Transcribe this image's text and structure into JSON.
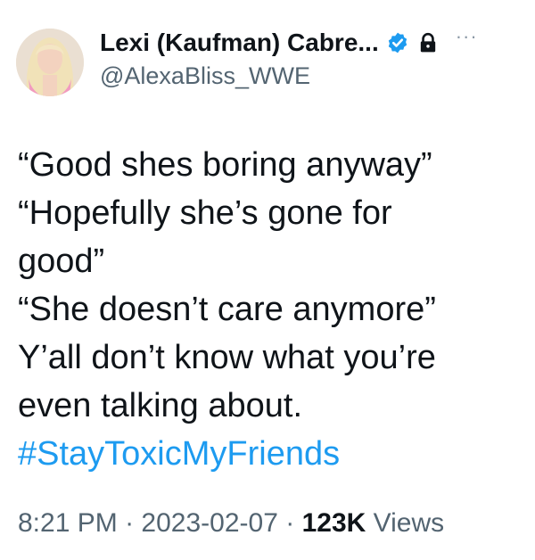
{
  "author": {
    "display_name": "Lexi (Kaufman) Cabre...",
    "handle": "@AlexaBliss_WWE",
    "verified_icon": "verified-badge-icon",
    "lock_icon": "lock-icon",
    "more_icon": "more-options-icon",
    "more_label": "···"
  },
  "tweet": {
    "lines": [
      "“Good shes boring anyway”",
      "“Hopefully she’s gone for",
      "good”",
      "“She doesn’t care anymore”",
      "Y’all don’t know what you’re",
      "even talking about."
    ],
    "hashtag": "#StayToxicMyFriends"
  },
  "meta": {
    "time": "8:21 PM",
    "separator": "·",
    "date": "2023-02-07",
    "views_count": "123K",
    "views_label": "Views"
  },
  "colors": {
    "text": "#0f1419",
    "secondary": "#536471",
    "link": "#1d9bf0",
    "verified": "#1d9bf0"
  }
}
